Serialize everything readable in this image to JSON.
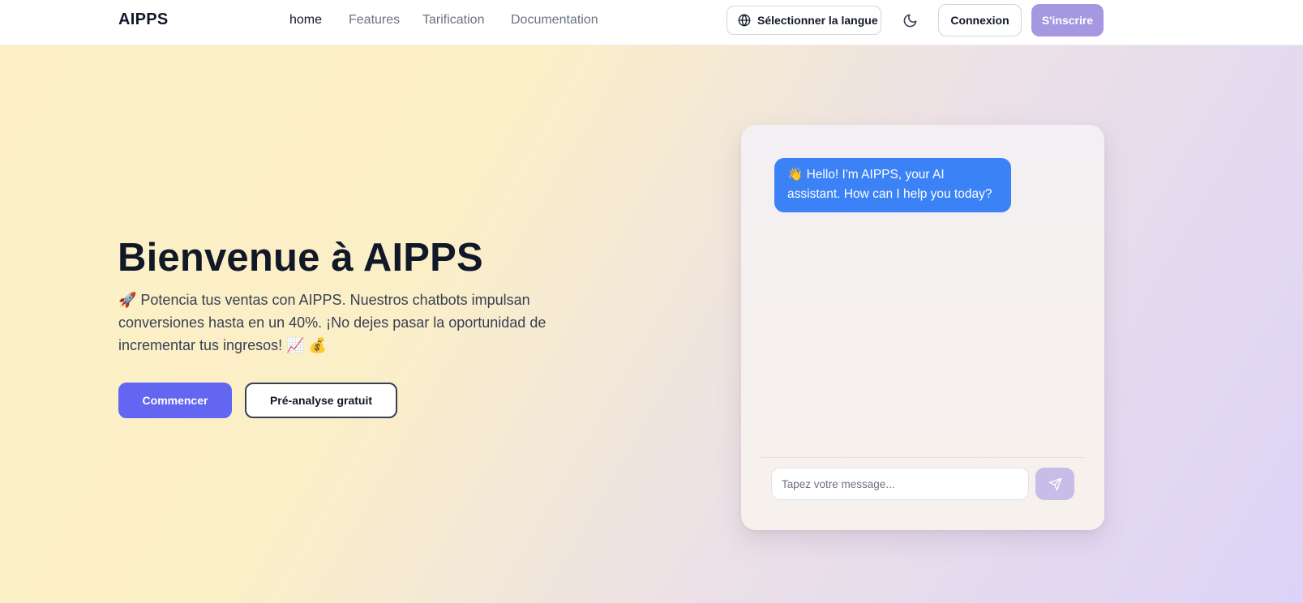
{
  "header": {
    "brand": "AIPPS",
    "nav": [
      {
        "label": "home"
      },
      {
        "label": "Features"
      },
      {
        "label": "Tarification"
      },
      {
        "label": "Documentation"
      }
    ],
    "language_button": "Sélectionner la langue",
    "login": "Connexion",
    "signup": "S'inscrire"
  },
  "hero": {
    "title": "Bienvenue à AIPPS",
    "subtitle": "🚀 Potencia tus ventas con AIPPS. Nuestros chatbots impulsan conversiones hasta en un 40%. ¡No dejes pasar la oportunidad de incrementar tus ingresos! 📈 💰",
    "cta_primary": "Commencer",
    "cta_secondary": "Pré-analyse gratuit"
  },
  "chat": {
    "bot_message": "👋 Hello! I'm AIPPS, your AI assistant. How can I help you today?",
    "input_placeholder": "Tapez votre message...",
    "input_value": ""
  },
  "icons": {
    "language": "globe-icon",
    "theme": "moon-icon",
    "send": "send-icon"
  },
  "colors": {
    "primary": "#6366f1",
    "signup": "#a597e0",
    "bubble": "#3b82f6",
    "send_button": "#c6bde9"
  }
}
